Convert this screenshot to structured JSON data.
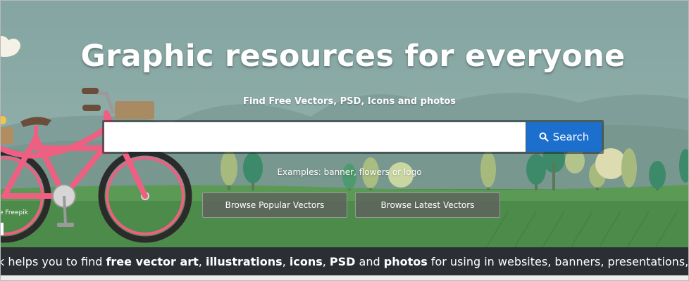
{
  "hero": {
    "title": "Graphic resources for everyone",
    "subtitle": "Find Free Vectors, PSD, Icons and photos"
  },
  "search": {
    "value": "",
    "placeholder": "",
    "button_label": "Search",
    "button_icon": "search-icon",
    "examples": "Examples: banner, flowers or logo"
  },
  "browse": {
    "popular_label": "Browse Popular Vectors",
    "latest_label": "Browse Latest Vectors"
  },
  "illustration": {
    "credit": "e Freepik"
  },
  "tagline": {
    "parts": [
      {
        "text": "k helps you to find ",
        "bold": false
      },
      {
        "text": "free vector art",
        "bold": true
      },
      {
        "text": ", ",
        "bold": false
      },
      {
        "text": "illustrations",
        "bold": true
      },
      {
        "text": ", ",
        "bold": false
      },
      {
        "text": "icons",
        "bold": true
      },
      {
        "text": ", ",
        "bold": false
      },
      {
        "text": "PSD",
        "bold": true
      },
      {
        "text": " and ",
        "bold": false
      },
      {
        "text": "photos",
        "bold": true
      },
      {
        "text": " for using in websites, banners, presentations, ma",
        "bold": false
      }
    ]
  },
  "colors": {
    "sky": "#8aaaa6",
    "search_button": "#1d6fce",
    "bike_frame": "#ef5f82",
    "grass": "#4f8f4c",
    "tagline_bar": "#2b2f33"
  }
}
